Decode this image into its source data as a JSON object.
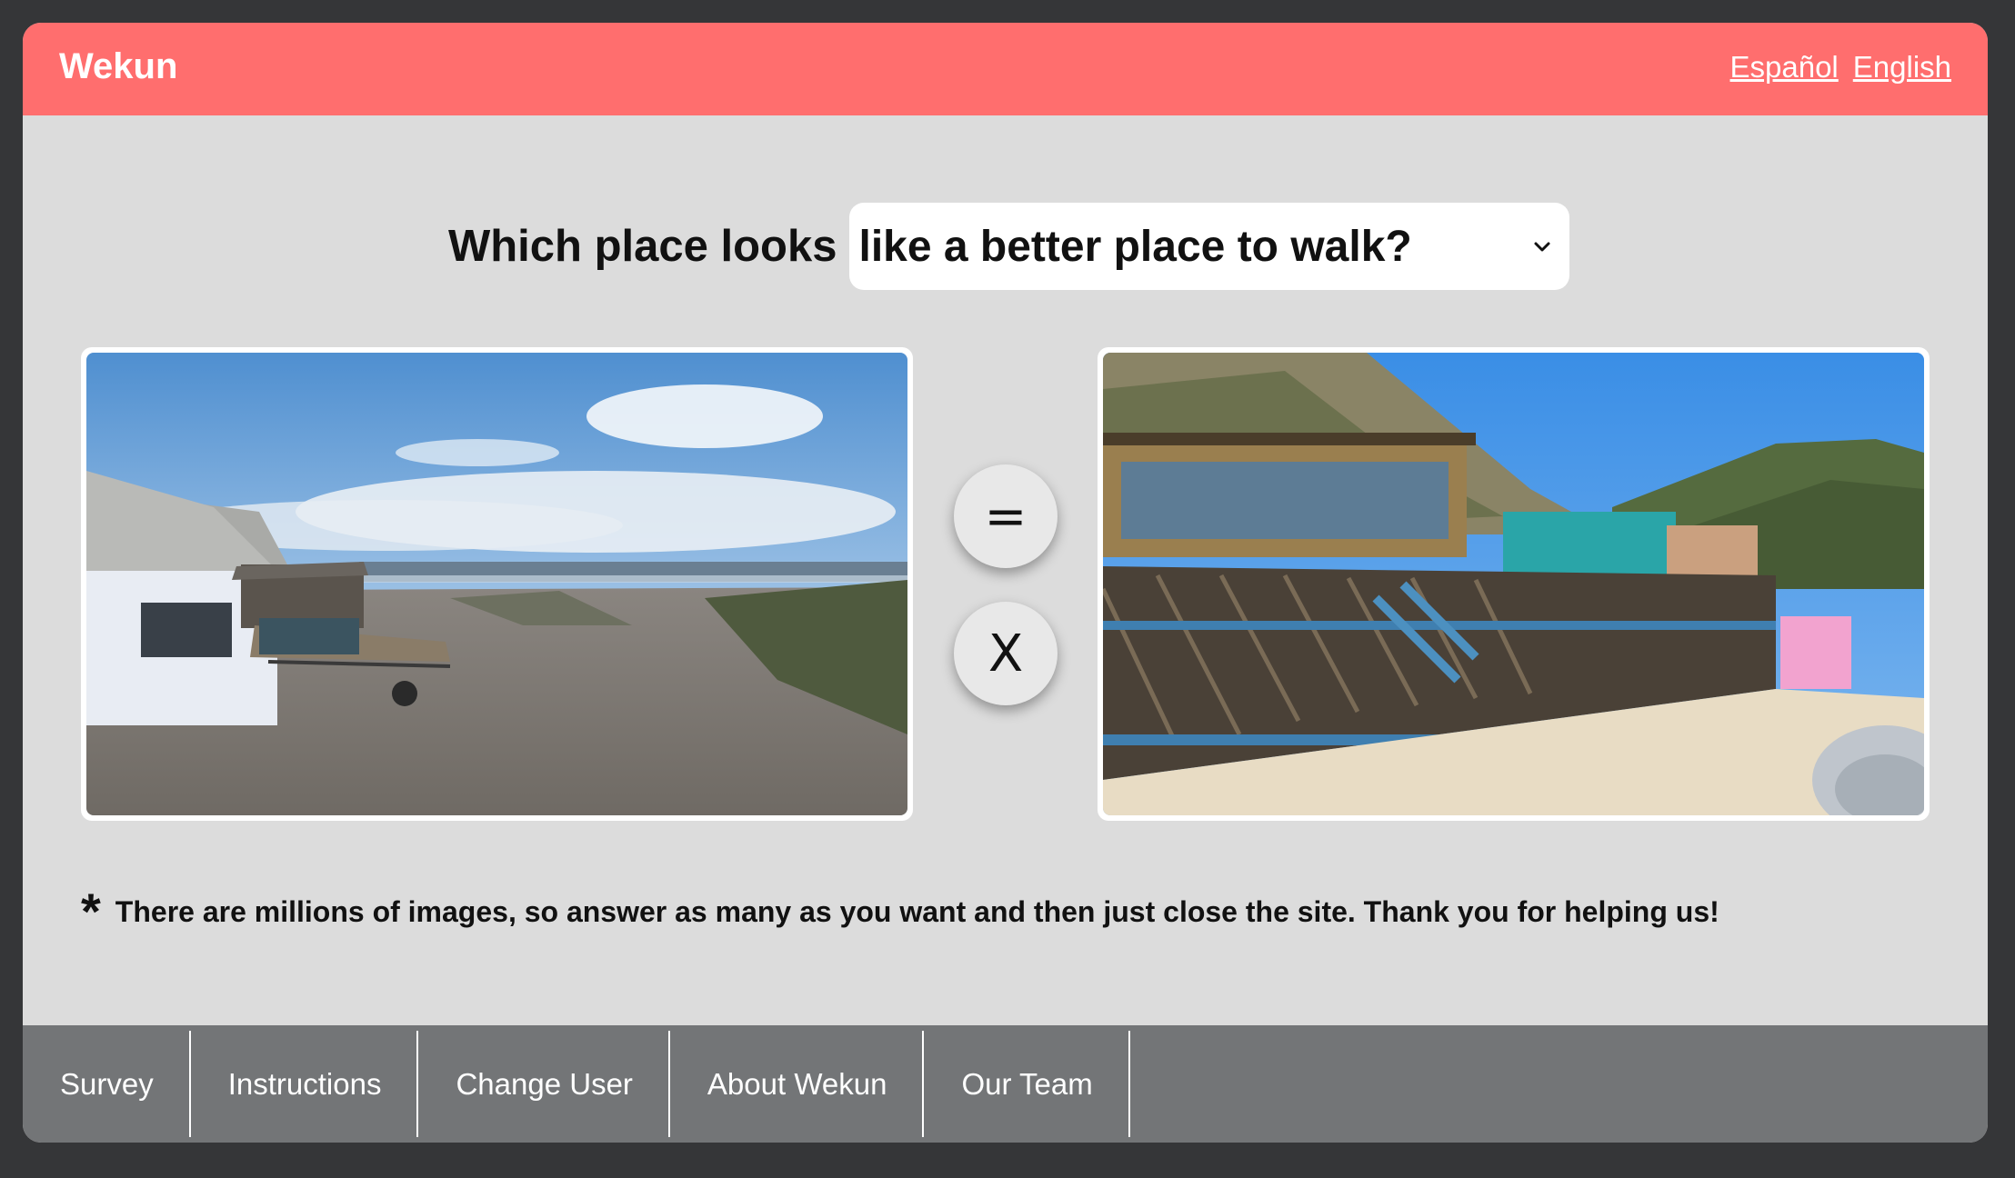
{
  "header": {
    "brand": "Wekun",
    "languages": [
      "Español",
      "English"
    ]
  },
  "question": {
    "prefix": "Which place looks",
    "selected_option": "like a better place to walk?"
  },
  "choices": {
    "equal_label": "=",
    "skip_label": "X"
  },
  "note": {
    "marker": "*",
    "text": "There are millions of images, so answer as many as you want and then just close the site. Thank you for helping us!"
  },
  "footer": {
    "nav": [
      "Survey",
      "Instructions",
      "Change User",
      "About Wekun",
      "Our Team"
    ]
  },
  "colors": {
    "header_bg": "#ff6e6e",
    "footer_bg": "#737577",
    "page_bg": "#dcdcdc",
    "frame_bg": "#353638"
  },
  "icons": {
    "select_caret": "chevron-down-icon"
  }
}
